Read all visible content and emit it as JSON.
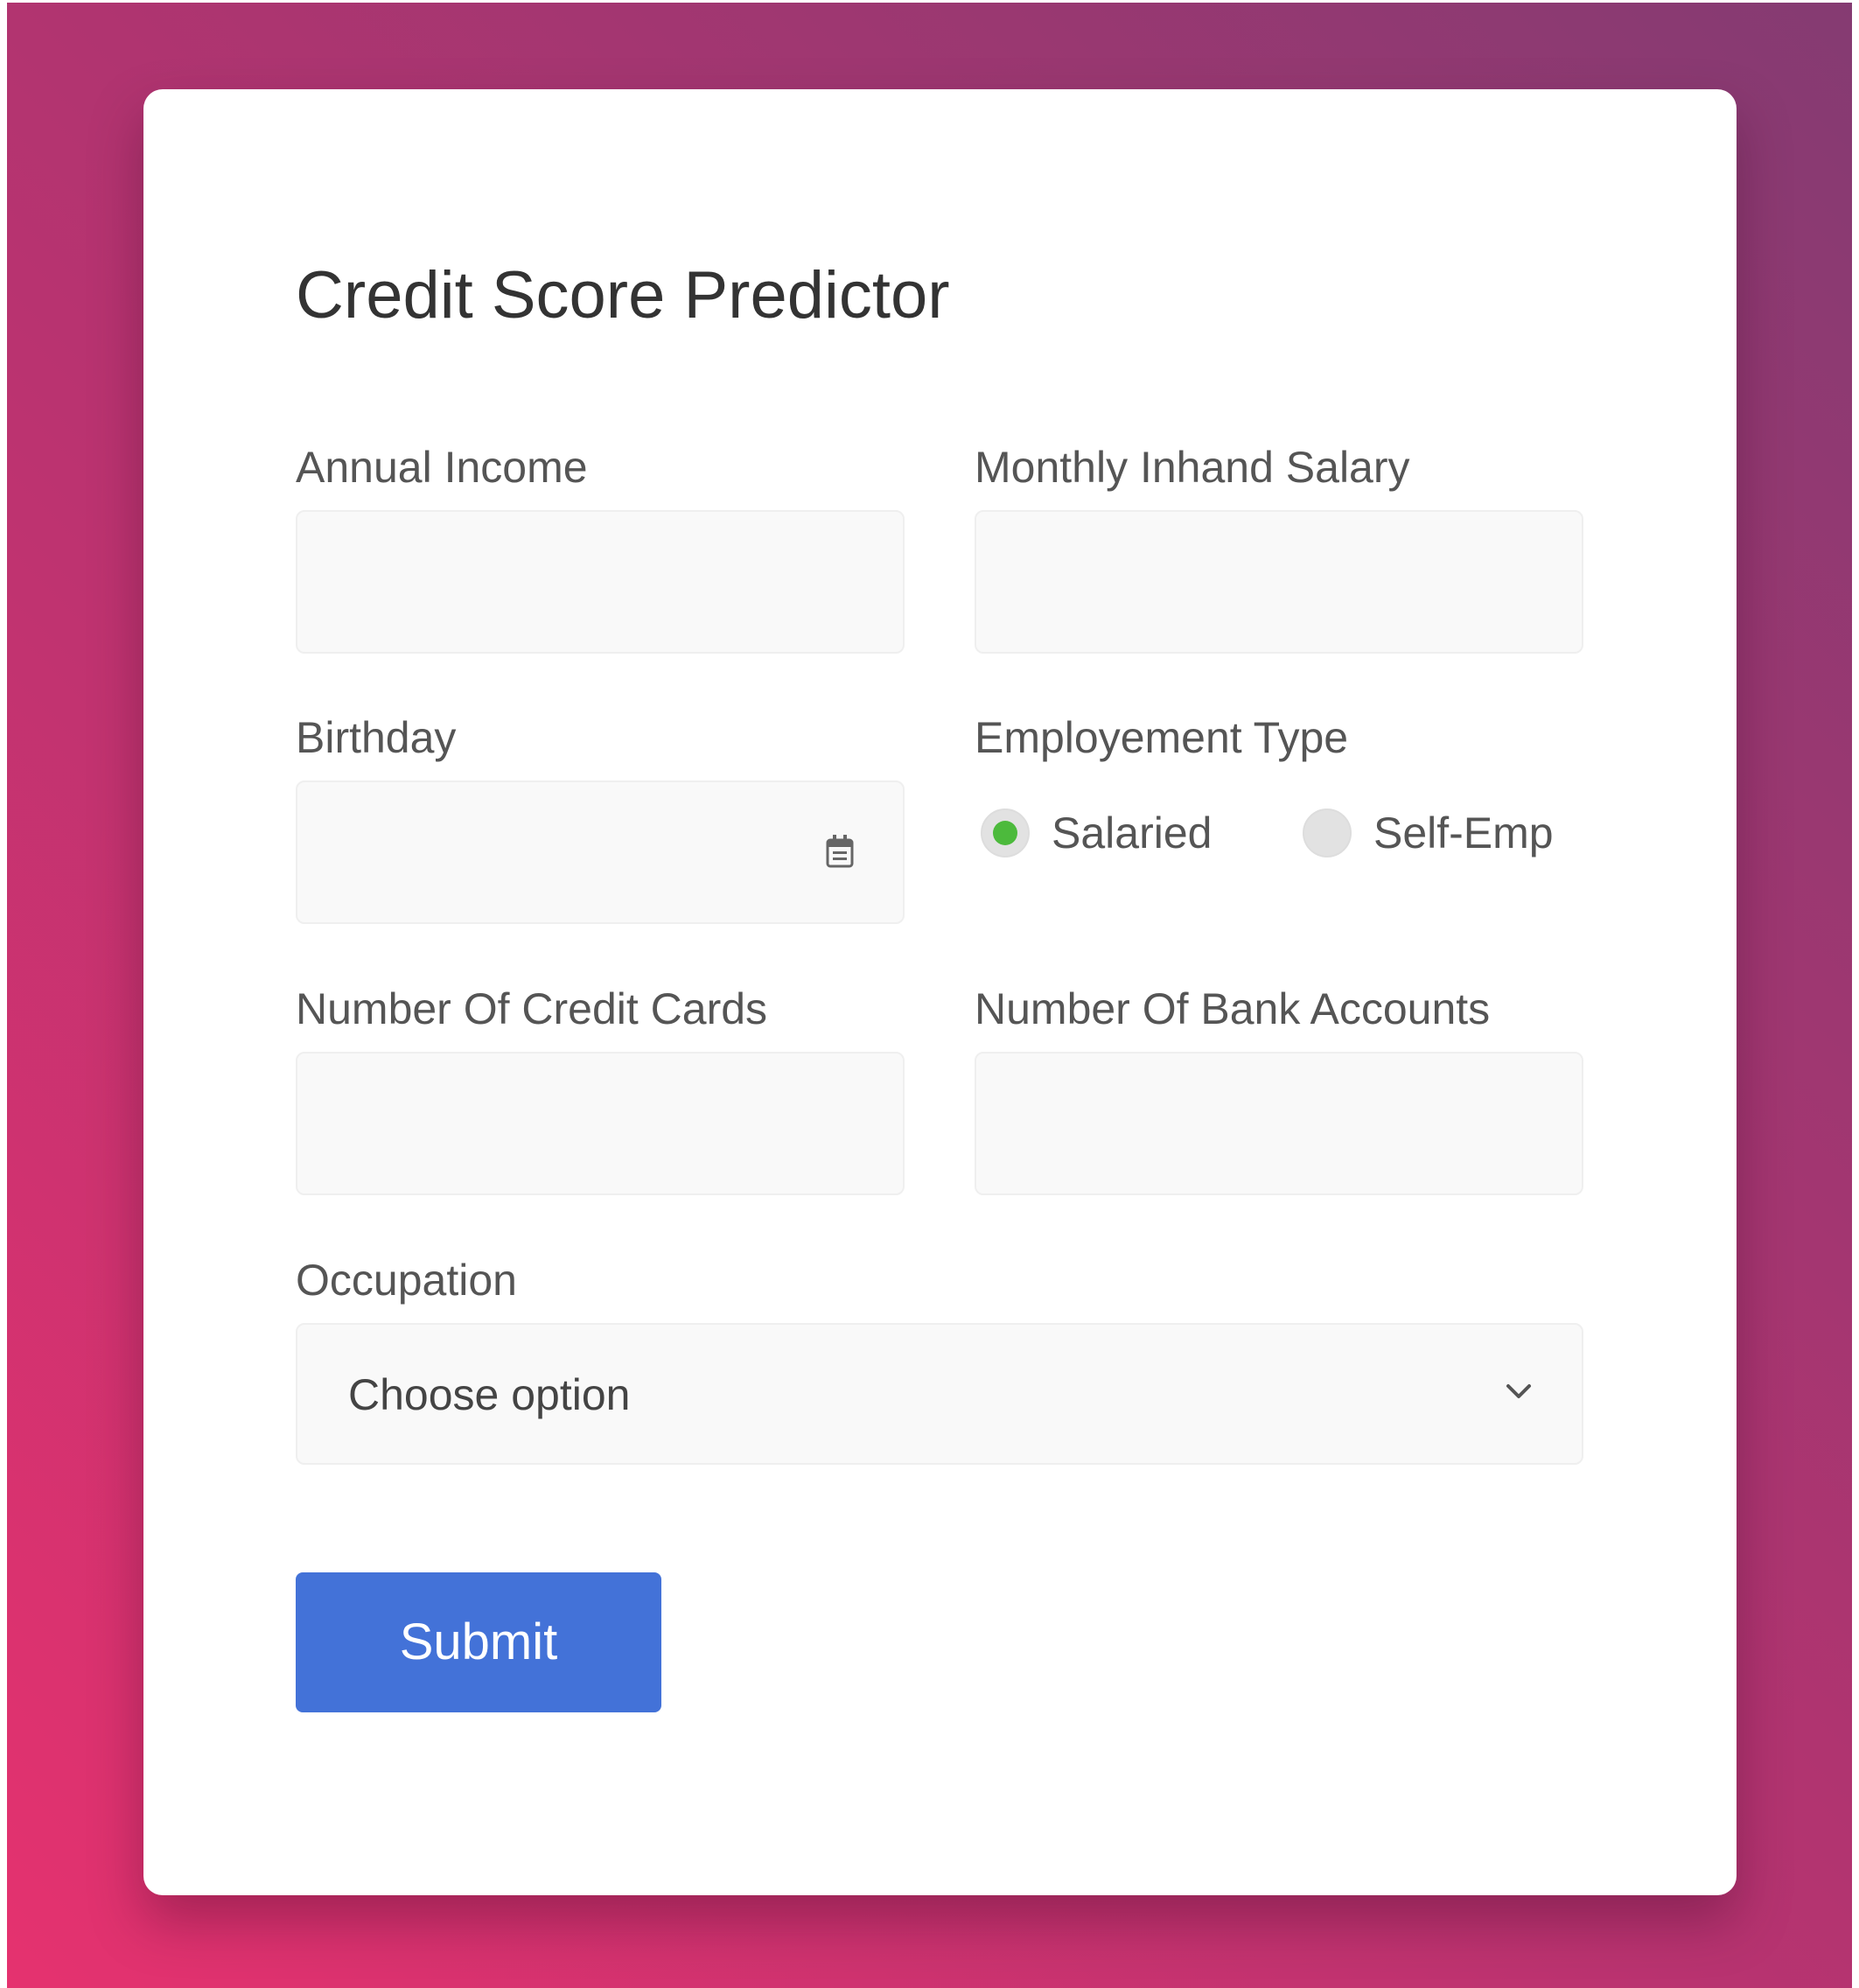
{
  "form": {
    "title": "Credit Score Predictor",
    "fields": {
      "annual_income": {
        "label": "Annual Income",
        "value": ""
      },
      "monthly_inhand_salary": {
        "label": "Monthly Inhand Salary",
        "value": ""
      },
      "birthday": {
        "label": "Birthday",
        "value": ""
      },
      "employment_type": {
        "label": "Employement Type",
        "options": [
          {
            "label": "Salaried",
            "checked": true
          },
          {
            "label": "Self-Emp",
            "checked": false
          }
        ]
      },
      "num_credit_cards": {
        "label": "Number Of Credit Cards",
        "value": ""
      },
      "num_bank_accounts": {
        "label": "Number Of Bank Accounts",
        "value": ""
      },
      "occupation": {
        "label": "Occupation",
        "selected": "Choose option"
      }
    },
    "submit_label": "Submit"
  },
  "colors": {
    "background_start": "#e5326f",
    "background_end": "#853b72",
    "primary_button": "#4372d8",
    "radio_checked": "#4cba3c",
    "input_bg": "#f9f9f9"
  },
  "icons": {
    "date_picker": "calendar-icon",
    "select_dropdown": "chevron-down-icon"
  }
}
